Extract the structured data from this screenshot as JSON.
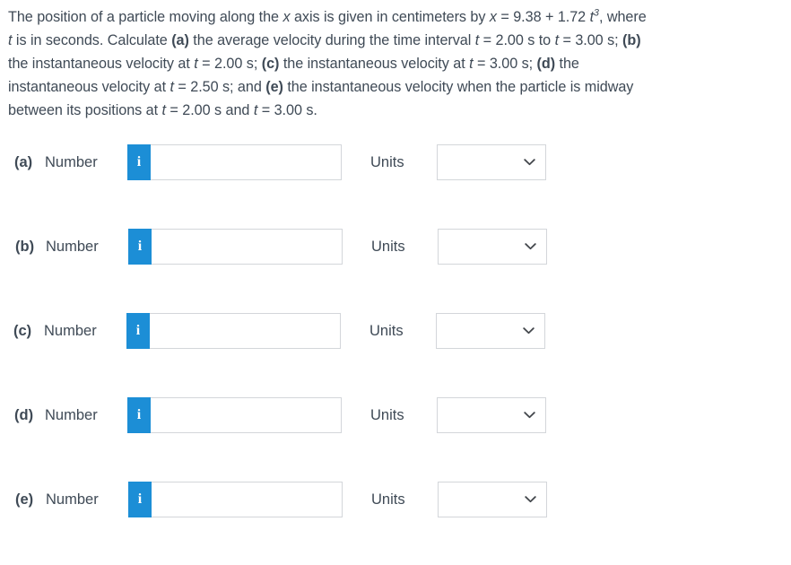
{
  "problem": {
    "lines": [
      {
        "parts": [
          {
            "t": "The position of a particle moving along the ",
            "s": "plain"
          },
          {
            "t": "x",
            "s": "italic"
          },
          {
            "t": " axis is given in centimeters by ",
            "s": "plain"
          },
          {
            "t": "x",
            "s": "italic"
          },
          {
            "t": " = 9.38 + 1.72 ",
            "s": "plain"
          },
          {
            "t": "t",
            "s": "italic"
          },
          {
            "t": "3",
            "s": "sup"
          },
          {
            "t": ", where",
            "s": "plain"
          }
        ]
      },
      {
        "parts": [
          {
            "t": "t",
            "s": "italic"
          },
          {
            "t": " is in seconds. Calculate ",
            "s": "plain"
          },
          {
            "t": "(a)",
            "s": "bold"
          },
          {
            "t": " the average velocity during the time interval ",
            "s": "plain"
          },
          {
            "t": "t",
            "s": "italic"
          },
          {
            "t": " = 2.00 s to ",
            "s": "plain"
          },
          {
            "t": "t",
            "s": "italic"
          },
          {
            "t": " = 3.00 s; ",
            "s": "plain"
          },
          {
            "t": "(b)",
            "s": "bold"
          }
        ]
      },
      {
        "parts": [
          {
            "t": "the instantaneous velocity at ",
            "s": "plain"
          },
          {
            "t": "t",
            "s": "italic"
          },
          {
            "t": " = 2.00 s; ",
            "s": "plain"
          },
          {
            "t": "(c)",
            "s": "bold"
          },
          {
            "t": " the instantaneous velocity at ",
            "s": "plain"
          },
          {
            "t": "t",
            "s": "italic"
          },
          {
            "t": " = 3.00 s; ",
            "s": "plain"
          },
          {
            "t": "(d)",
            "s": "bold"
          },
          {
            "t": " the",
            "s": "plain"
          }
        ]
      },
      {
        "parts": [
          {
            "t": "instantaneous velocity at ",
            "s": "plain"
          },
          {
            "t": "t",
            "s": "italic"
          },
          {
            "t": " = 2.50 s; and ",
            "s": "plain"
          },
          {
            "t": "(e)",
            "s": "bold"
          },
          {
            "t": " the instantaneous velocity when the particle is midway",
            "s": "plain"
          }
        ]
      },
      {
        "parts": [
          {
            "t": "between its positions at ",
            "s": "plain"
          },
          {
            "t": "t",
            "s": "italic"
          },
          {
            "t": " = 2.00 s and ",
            "s": "plain"
          },
          {
            "t": "t",
            "s": "italic"
          },
          {
            "t": " = 3.00 s.",
            "s": "plain"
          }
        ]
      }
    ]
  },
  "answers": {
    "number_label": "Number",
    "units_label": "Units",
    "info_icon_glyph": "i",
    "chevron_icon": "chevron-down-icon",
    "accent_color": "#1c8ed6",
    "border_color": "#d3d6da",
    "text_color": "#3f4a56",
    "rows": [
      {
        "part": "(a)",
        "number_value": "",
        "number_placeholder": "",
        "units_value": "",
        "offset_left": 0
      },
      {
        "part": "(b)",
        "number_value": "",
        "number_placeholder": "",
        "units_value": "",
        "offset_left": 1
      },
      {
        "part": "(c)",
        "number_value": "",
        "number_placeholder": "",
        "units_value": "",
        "offset_left": -1
      },
      {
        "part": "(d)",
        "number_value": "",
        "number_placeholder": "",
        "units_value": "",
        "offset_left": 0
      },
      {
        "part": "(e)",
        "number_value": "",
        "number_placeholder": "",
        "units_value": "",
        "offset_left": 1
      }
    ],
    "units_options": [
      ""
    ]
  }
}
